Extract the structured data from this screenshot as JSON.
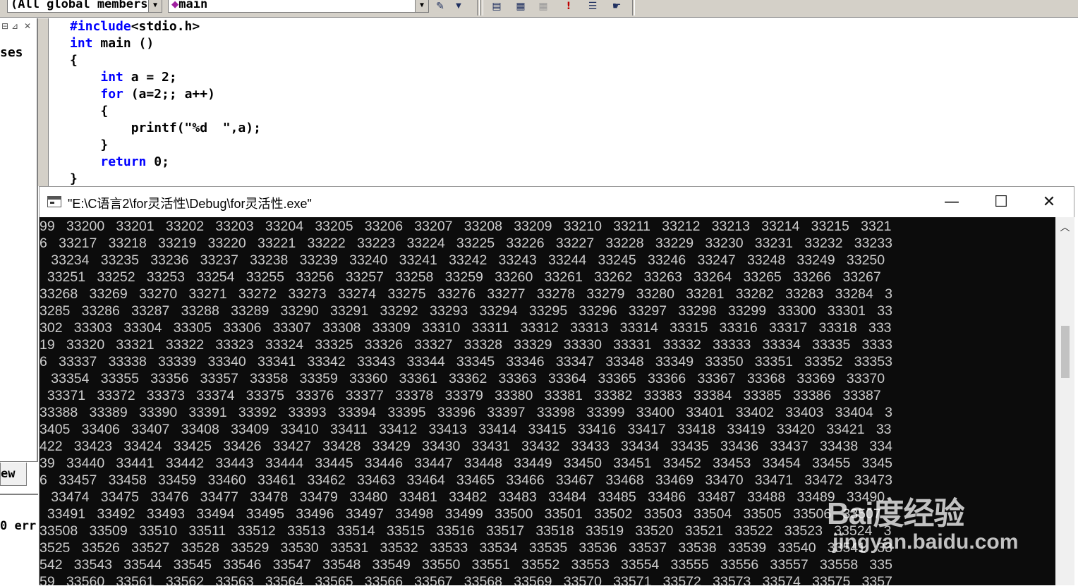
{
  "toolbar": {
    "scope_combo": "(All global members",
    "function_combo": "main",
    "icons": [
      "wizard-icon",
      "dropdown-icon",
      "build-icon",
      "compile-icon",
      "stop-icon",
      "debug-icon",
      "step-icon",
      "hand-icon"
    ]
  },
  "workspace": {
    "label": "ses",
    "tab_label": "ew",
    "output_label": "0 err"
  },
  "editor": {
    "lines": [
      [
        {
          "t": "#include",
          "k": true
        },
        {
          "t": "<stdio.h>",
          "k": false
        }
      ],
      [
        {
          "t": "int",
          "k": true
        },
        {
          "t": " main ()",
          "k": false
        }
      ],
      [
        {
          "t": "{",
          "k": false
        }
      ],
      [
        {
          "t": "    ",
          "k": false
        },
        {
          "t": "int",
          "k": true
        },
        {
          "t": " a = 2;",
          "k": false
        }
      ],
      [
        {
          "t": "    ",
          "k": false
        },
        {
          "t": "for",
          "k": true
        },
        {
          "t": " (a=2;; a++)",
          "k": false
        }
      ],
      [
        {
          "t": "    {",
          "k": false
        }
      ],
      [
        {
          "t": "        printf(\"%d  \",a);",
          "k": false
        }
      ],
      [
        {
          "t": "    }",
          "k": false
        }
      ],
      [
        {
          "t": "    ",
          "k": false
        },
        {
          "t": "return",
          "k": true
        },
        {
          "t": " 0;",
          "k": false
        }
      ],
      [
        {
          "t": "}",
          "k": false
        }
      ]
    ]
  },
  "console": {
    "title": "\"E:\\C语言2\\for灵活性\\Debug\\for灵活性.exe\"",
    "minimize": "—",
    "maximize": "☐",
    "close": "✕",
    "lines": [
      "99   33200   33201   33202   33203   33204   33205   33206   33207   33208   33209   33210   33211   33212   33213   33214   33215   3321",
      "6   33217   33218   33219   33220   33221   33222   33223   33224   33225   33226   33227   33228   33229   33230   33231   33232   33233",
      "   33234   33235   33236   33237   33238   33239   33240   33241   33242   33243   33244   33245   33246   33247   33248   33249   33250",
      "  33251   33252   33253   33254   33255   33256   33257   33258   33259   33260   33261   33262   33263   33264   33265   33266   33267",
      "33268   33269   33270   33271   33272   33273   33274   33275   33276   33277   33278   33279   33280   33281   33282   33283   33284   3",
      "3285   33286   33287   33288   33289   33290   33291   33292   33293   33294   33295   33296   33297   33298   33299   33300   33301   33",
      "302   33303   33304   33305   33306   33307   33308   33309   33310   33311   33312   33313   33314   33315   33316   33317   33318   333",
      "19   33320   33321   33322   33323   33324   33325   33326   33327   33328   33329   33330   33331   33332   33333   33334   33335   3333",
      "6   33337   33338   33339   33340   33341   33342   33343   33344   33345   33346   33347   33348   33349   33350   33351   33352   33353",
      "   33354   33355   33356   33357   33358   33359   33360   33361   33362   33363   33364   33365   33366   33367   33368   33369   33370",
      "  33371   33372   33373   33374   33375   33376   33377   33378   33379   33380   33381   33382   33383   33384   33385   33386   33387",
      "33388   33389   33390   33391   33392   33393   33394   33395   33396   33397   33398   33399   33400   33401   33402   33403   33404   3",
      "3405   33406   33407   33408   33409   33410   33411   33412   33413   33414   33415   33416   33417   33418   33419   33420   33421   33",
      "422   33423   33424   33425   33426   33427   33428   33429   33430   33431   33432   33433   33434   33435   33436   33437   33438   334",
      "39   33440   33441   33442   33443   33444   33445   33446   33447   33448   33449   33450   33451   33452   33453   33454   33455   3345",
      "6   33457   33458   33459   33460   33461   33462   33463   33464   33465   33466   33467   33468   33469   33470   33471   33472   33473",
      "   33474   33475   33476   33477   33478   33479   33480   33481   33482   33483   33484   33485   33486   33487   33488   33489   33490",
      "  33491   33492   33493   33494   33495   33496   33497   33498   33499   33500   33501   33502   33503   33504   33505   33506   33507",
      "33508   33509   33510   33511   33512   33513   33514   33515   33516   33517   33518   33519   33520   33521   33522   33523   33524   3",
      "3525   33526   33527   33528   33529   33530   33531   33532   33533   33534   33535   33536   33537   33538   33539   33540   33541   33",
      "542   33543   33544   33545   33546   33547   33548   33549   33550   33551   33552   33553   33554   33555   33556   33557   33558   335",
      "59   33560   33561   33562   33563   33564   33565   33566   33567   33568   33569   33570   33571   33572   33573   33574   33575   3357"
    ]
  },
  "watermark": {
    "logo": "Bai度经验",
    "url": "jingyan.baidu.com"
  }
}
